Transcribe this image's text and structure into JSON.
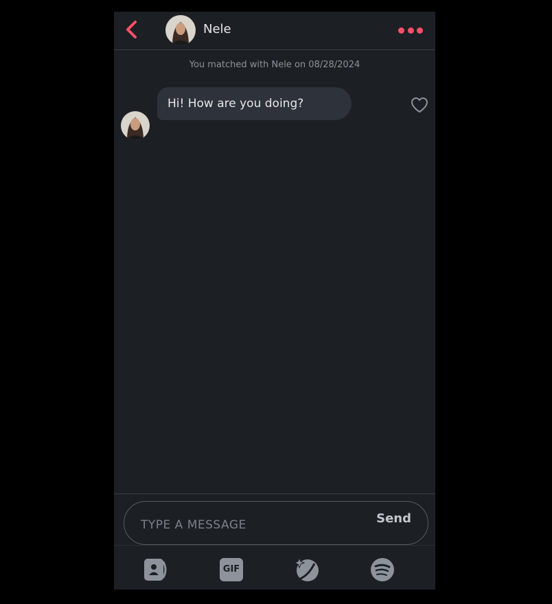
{
  "header": {
    "contact_name": "Nele"
  },
  "chat": {
    "match_notice": "You matched with Nele on 08/28/2024",
    "messages": [
      {
        "sender": "Nele",
        "text": "Hi! How are you doing?"
      }
    ]
  },
  "composer": {
    "placeholder": "TYPE A MESSAGE",
    "value": "",
    "send_label": "Send"
  },
  "toolbar": {
    "gif_label": "GIF",
    "items": [
      "contact-card-icon",
      "gif-icon",
      "sticker-icon",
      "spotify-icon"
    ]
  },
  "colors": {
    "accent": "#fd5068",
    "background": "#1c1f24",
    "bubble": "#2e323a"
  }
}
